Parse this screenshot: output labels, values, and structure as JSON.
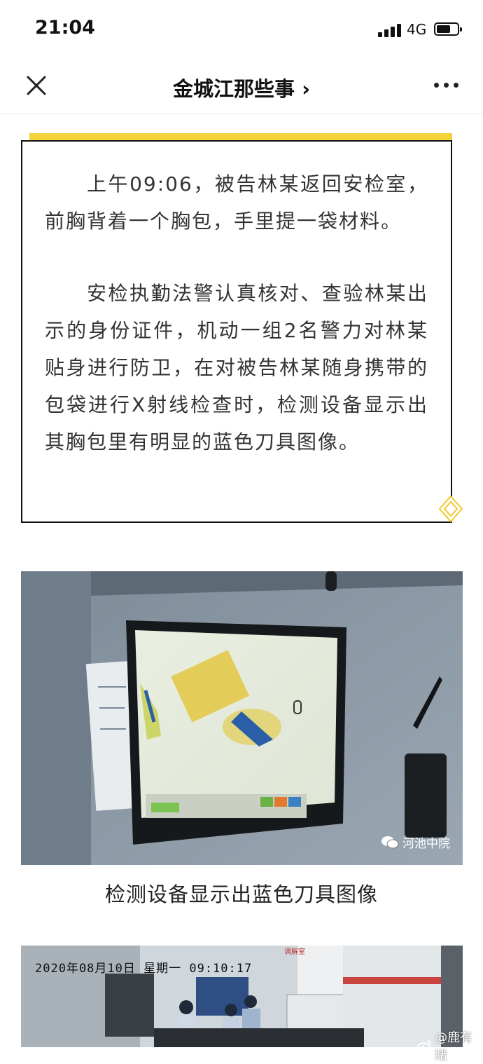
{
  "status_bar": {
    "time": "21:04",
    "network": "4G"
  },
  "nav": {
    "title": "金城江那些事 ›"
  },
  "article": {
    "paragraphs": [
      "上午09:06，被告林某返回安检室，前胸背着一个胸包，手里提一袋材料。",
      "安检执勤法警认真核对、查验林某出示的身份证件，机动一组2名警力对林某贴身进行防卫，在对被告林某随身携带的包袋进行X射线检查时，检测设备显示出其胸包里有明显的蓝色刀具图像。"
    ],
    "image1_watermark": "河池中院",
    "image1_caption": "检测设备显示出蓝色刀具图像",
    "image2_timestamp": "2020年08月10日  星期一  09:10:17",
    "image2_sign": "调解室",
    "weibo_watermark": "@鹿有睹"
  },
  "colors": {
    "accent_yellow": "#f3d33a",
    "text": "#333333"
  }
}
